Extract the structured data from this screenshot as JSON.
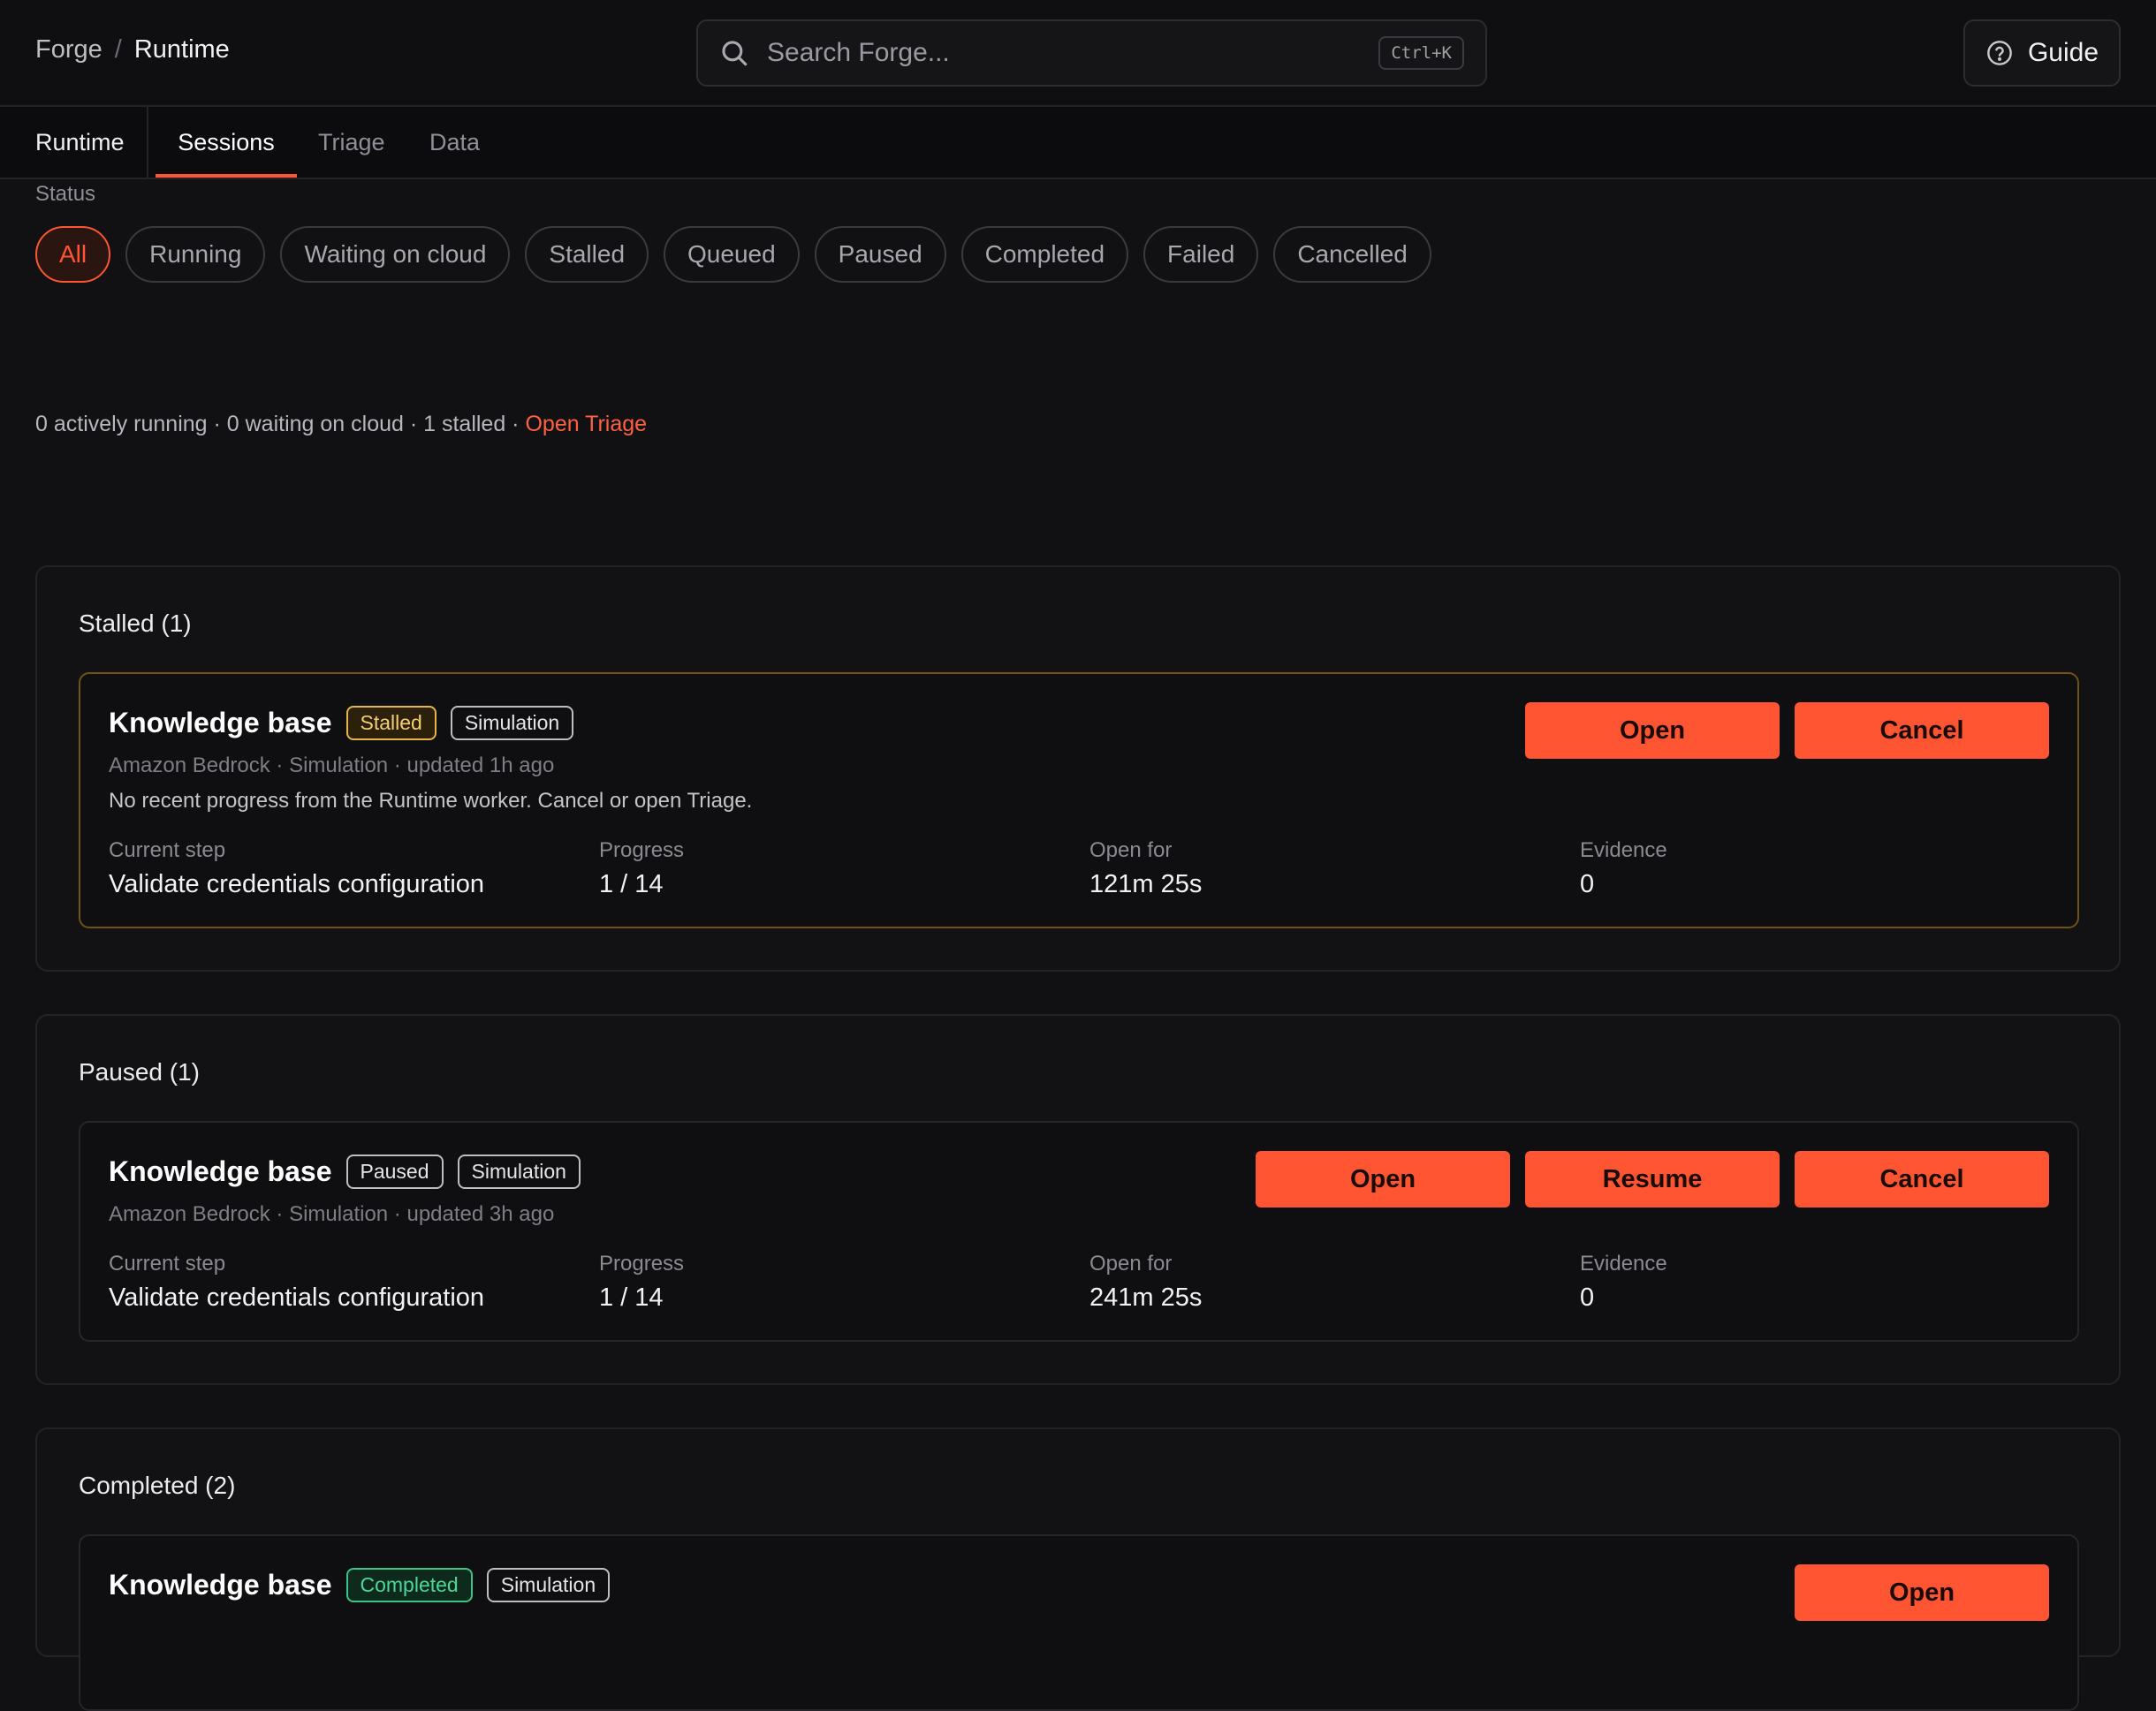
{
  "breadcrumb": {
    "root": "Forge",
    "separator": "/",
    "current": "Runtime"
  },
  "search": {
    "placeholder": "Search Forge...",
    "shortcut": "Ctrl+K"
  },
  "guide_label": "Guide",
  "tabs": [
    {
      "label": "Runtime"
    },
    {
      "label": "Sessions",
      "active": true
    },
    {
      "label": "Triage"
    },
    {
      "label": "Data"
    }
  ],
  "filters": {
    "label": "Status",
    "options": [
      "All",
      "Running",
      "Waiting on cloud",
      "Stalled",
      "Queued",
      "Paused",
      "Completed",
      "Failed",
      "Cancelled"
    ],
    "selected": "All"
  },
  "summary": {
    "text": "0 actively running · 0 waiting on cloud · 1 stalled · ",
    "link": "Open Triage"
  },
  "field_labels": {
    "step": "Current step",
    "progress": "Progress",
    "open_for": "Open for",
    "evidence": "Evidence"
  },
  "groups": {
    "stalled": {
      "title": "Stalled (1)",
      "card": {
        "name": "Knowledge base",
        "status_badge": "Stalled",
        "mode_badge": "Simulation",
        "meta": "Amazon Bedrock · Simulation · updated 1h ago",
        "note": "No recent progress from the Runtime worker. Cancel or open Triage.",
        "step": "Validate credentials configuration",
        "progress": "1 / 14",
        "open_for": "121m 25s",
        "evidence": "0",
        "actions": [
          "Open",
          "Cancel"
        ]
      }
    },
    "paused": {
      "title": "Paused (1)",
      "card": {
        "name": "Knowledge base",
        "status_badge": "Paused",
        "mode_badge": "Simulation",
        "meta": "Amazon Bedrock · Simulation · updated 3h ago",
        "step": "Validate credentials configuration",
        "progress": "1 / 14",
        "open_for": "241m 25s",
        "evidence": "0",
        "actions": [
          "Open",
          "Resume",
          "Cancel"
        ]
      }
    },
    "completed": {
      "title": "Completed (2)",
      "card": {
        "name": "Knowledge base",
        "status_badge": "Completed",
        "mode_badge": "Simulation",
        "actions": [
          "Open"
        ]
      }
    }
  },
  "colors": {
    "accent": "#ff5533",
    "stalled": "#e8b44a",
    "completed": "#3bc488",
    "background": "#111113"
  }
}
